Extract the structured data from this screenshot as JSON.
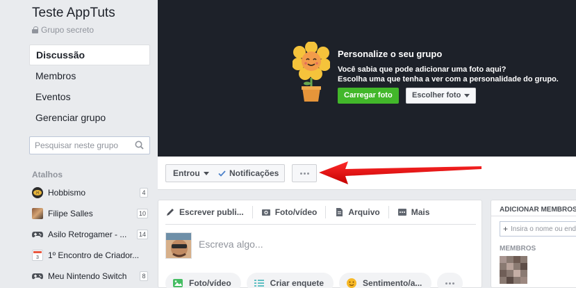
{
  "group": {
    "title": "Teste AppTuts",
    "type": "Grupo secreto"
  },
  "nav": [
    {
      "label": "Discussão",
      "active": true
    },
    {
      "label": "Membros",
      "active": false
    },
    {
      "label": "Eventos",
      "active": false
    },
    {
      "label": "Gerenciar grupo",
      "active": false
    }
  ],
  "search": {
    "placeholder": "Pesquisar neste grupo",
    "icon": "search-icon"
  },
  "shortcuts": {
    "title": "Atalhos",
    "items": [
      {
        "label": "Hobbismo",
        "count": "4",
        "icon": "hobbismo-icon"
      },
      {
        "label": "Filipe Salles",
        "count": "10",
        "icon": "avatar-icon"
      },
      {
        "label": "Asilo Retrogamer - ...",
        "count": "14",
        "icon": "gamepad-icon"
      },
      {
        "label": "1º Encontro de Criador...",
        "count": "",
        "icon": "calendar-icon"
      },
      {
        "label": "Meu Nintendo Switch",
        "count": "8",
        "icon": "gamepad-icon"
      }
    ]
  },
  "cover": {
    "title": "Personalize o seu grupo",
    "line1": "Você sabia que pode adicionar uma foto aqui?",
    "line2": "Escolha uma que tenha a ver com a personalidade do grupo.",
    "upload_label": "Carregar foto",
    "choose_label": "Escolher foto",
    "colors": {
      "background": "#1d2129",
      "upload": "#42b72a"
    }
  },
  "actions": {
    "joined_label": "Entrou",
    "notifications_label": "Notificações",
    "more_icon": "more-dots-icon"
  },
  "composer": {
    "tabs": [
      {
        "label": "Escrever publi...",
        "icon": "pencil-icon"
      },
      {
        "label": "Foto/vídeo",
        "icon": "camera-icon"
      },
      {
        "label": "Arquivo",
        "icon": "file-icon"
      },
      {
        "label": "Mais",
        "icon": "more-icon"
      }
    ],
    "placeholder": "Escreva algo...",
    "pills": [
      {
        "label": "Foto/vídeo",
        "icon": "photo-icon"
      },
      {
        "label": "Criar enquete",
        "icon": "poll-icon"
      },
      {
        "label": "Sentimento/a...",
        "icon": "emoji-icon"
      }
    ]
  },
  "right_panel": {
    "title": "ADICIONAR MEMBROS",
    "input_placeholder": "Insira o nome ou end",
    "members_label": "MEMBROS"
  }
}
